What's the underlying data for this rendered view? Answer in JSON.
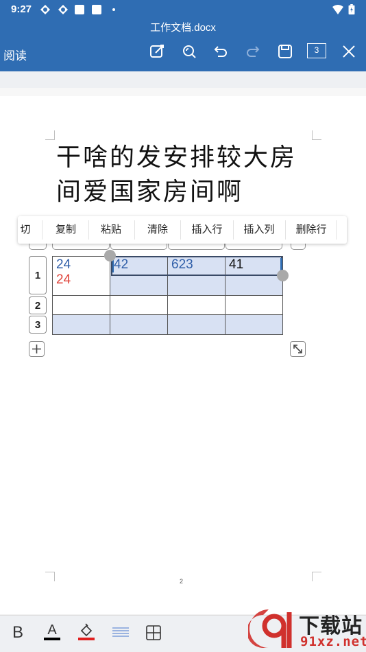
{
  "status": {
    "time": "9:27"
  },
  "header": {
    "doc_title": "工作文档.docx",
    "mode_label": "阅读",
    "page_count": "3"
  },
  "toolbar_icons": [
    "edit-icon",
    "find-icon",
    "undo-icon",
    "redo-icon",
    "save-icon",
    "page-count",
    "close-icon"
  ],
  "document": {
    "heading_line1": "干啥的发安排较大房",
    "heading_line2": "间爱国家房间啊",
    "page_number": "2"
  },
  "context_menu": {
    "items": [
      "切",
      "复制",
      "粘贴",
      "清除",
      "插入行",
      "插入列",
      "删除行"
    ]
  },
  "table": {
    "row_headers": [
      "1",
      "2",
      "3"
    ],
    "row1": {
      "a_line1": "24",
      "a_line2": "24",
      "b": "42",
      "c": "623",
      "d": "41"
    }
  },
  "bottom_toolbar": {
    "bold_label": "B",
    "font_color_label": "A",
    "font_color": "#000000",
    "highlight_color": "#e02020"
  },
  "watermark": {
    "title": "下载站",
    "site": "91xz.net"
  },
  "colors": {
    "accent": "#2f6db3",
    "selection": "#d8e1f3",
    "red_text": "#e0453c"
  }
}
